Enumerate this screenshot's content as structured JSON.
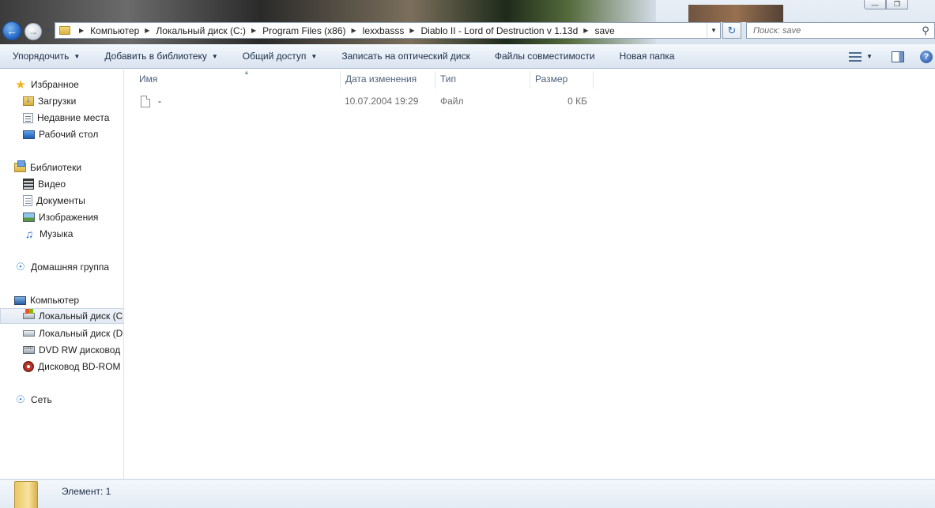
{
  "addressbar": {
    "breadcrumbs": [
      "Компьютер",
      "Локальный диск (C:)",
      "Program Files (x86)",
      "lexxbasss",
      "Diablo II - Lord of Destruction v 1.13d",
      "save"
    ]
  },
  "search": {
    "placeholder": "Поиск: save"
  },
  "toolbar": {
    "organize": "Упорядочить",
    "add_to_library": "Добавить в библиотеку",
    "share": "Общий доступ",
    "burn": "Записать на оптический диск",
    "compat_files": "Файлы совместимости",
    "new_folder": "Новая папка"
  },
  "navpane": {
    "favorites": "Избранное",
    "downloads": "Загрузки",
    "recent": "Недавние места",
    "desktop": "Рабочий стол",
    "libraries": "Библиотеки",
    "video": "Видео",
    "documents": "Документы",
    "images": "Изображения",
    "music": "Музыка",
    "homegroup": "Домашняя группа",
    "computer": "Компьютер",
    "drive_c": "Локальный диск (C",
    "drive_d": "Локальный диск (D",
    "dvd": "DVD RW дисковод (",
    "bd": "Дисковод BD-ROM",
    "network": "Сеть"
  },
  "columns": {
    "name": "Имя",
    "date": "Дата изменения",
    "type": "Тип",
    "size": "Размер"
  },
  "files": [
    {
      "name": "-",
      "date": "10.07.2004 19:29",
      "type": "Файл",
      "size": "0 КБ"
    }
  ],
  "status": {
    "text": "Элемент: 1"
  },
  "icons": {
    "back": "back-arrow-icon",
    "forward": "forward-arrow-icon",
    "refresh": "refresh-icon",
    "search": "search-icon",
    "help": "help-icon",
    "view": "view-options-icon",
    "preview_pane": "preview-pane-icon"
  },
  "colors": {
    "command_bar": "#dae4f0",
    "selected_nav": "#e2e9f2",
    "header_text": "#4c607a"
  }
}
